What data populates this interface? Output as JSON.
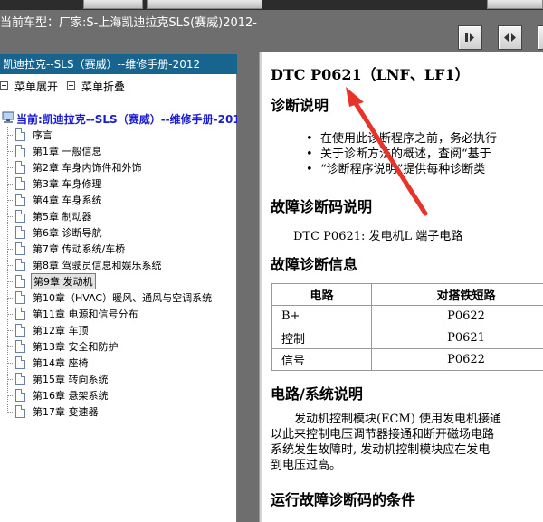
{
  "header": {
    "vehicle_model": "当前车型：厂家:S-上海凯迪拉克SLS(赛威)2012-"
  },
  "toolbar": {
    "buttons": [
      {
        "icon": "expand-right-icon"
      },
      {
        "icon": "fit-width-icon"
      }
    ]
  },
  "sidebar": {
    "title": "凯迪拉克--SLS（赛威）--维修手册-2012",
    "expand_label": "菜单展开",
    "collapse_label": "菜单折叠",
    "root_label": "当前:凯迪拉克--SLS（赛威）--维修手册-2012",
    "items": [
      {
        "label": "序言"
      },
      {
        "label": "第1章 一般信息"
      },
      {
        "label": "第2章 车身内饰件和外饰"
      },
      {
        "label": "第3章 车身修理"
      },
      {
        "label": "第4章 车身系统"
      },
      {
        "label": "第5章 制动器"
      },
      {
        "label": "第6章 诊断导航"
      },
      {
        "label": "第7章 传动系统/车桥"
      },
      {
        "label": "第8章 驾驶员信息和娱乐系统"
      },
      {
        "label": "第9章 发动机",
        "selected": true
      },
      {
        "label": "第10章（HVAC）暖风、通风与空调系统"
      },
      {
        "label": "第11章 电源和信号分布"
      },
      {
        "label": "第12章 车顶"
      },
      {
        "label": "第13章 安全和防护"
      },
      {
        "label": "第14章 座椅"
      },
      {
        "label": "第15章 转向系统"
      },
      {
        "label": "第16章 悬架系统"
      },
      {
        "label": "第17章 变速器"
      }
    ]
  },
  "document": {
    "title": "DTC P0621（LNF、LF1）",
    "section_diag_desc": "诊断说明",
    "bullets": [
      "在使用此诊断程序之前，务必执行",
      "关于诊断方法的概述，查阅“基于",
      "“诊断程序说明”提供每种诊断类"
    ],
    "section_dtc_desc": "故障诊断码说明",
    "dtc_line": "DTC P0621: 发电机L 端子电路",
    "section_dtc_info": "故障诊断信息",
    "table": {
      "headers": [
        "电路",
        "对搭铁短路"
      ],
      "rows": [
        [
          "B+",
          "P0622"
        ],
        [
          "控制",
          "P0621"
        ],
        [
          "信号",
          "P0622"
        ]
      ]
    },
    "section_circuit": "电路/系统说明",
    "paragraph": [
      "　　发动机控制模块(ECM) 使用发电机接通",
      "以此来控制电压调节器接通和断开磁场电路",
      "系统发生故障时, 发动机控制模块应在发电",
      "到电压过高。"
    ],
    "section_conditions": "运行故障诊断码的条件"
  },
  "colors": {
    "sidebar_title_bg": "#17658f",
    "root_label": "#1b1bd4",
    "annotation_arrow": "#e8332a",
    "background": "#6e6e6e"
  }
}
